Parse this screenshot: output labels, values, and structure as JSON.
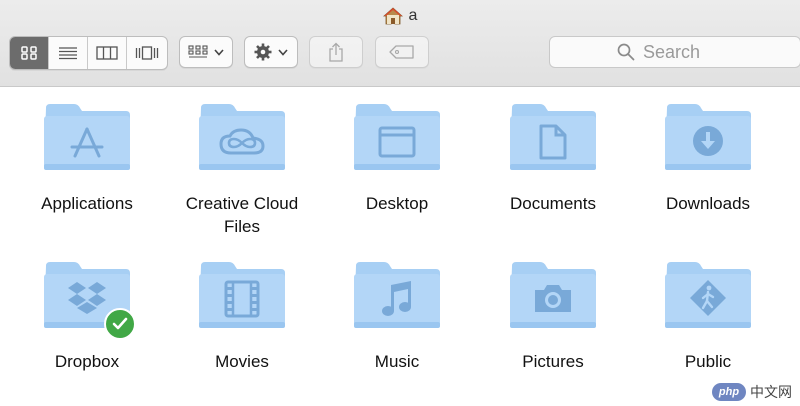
{
  "window": {
    "title": "a"
  },
  "toolbar": {
    "view_modes": [
      "icons",
      "list",
      "columns",
      "cover-flow"
    ],
    "active_view": "icons"
  },
  "search": {
    "placeholder": "Search"
  },
  "folders": [
    {
      "label": "Applications",
      "icon": "applications-icon"
    },
    {
      "label": "Creative Cloud Files",
      "icon": "creative-cloud-icon"
    },
    {
      "label": "Desktop",
      "icon": "desktop-icon"
    },
    {
      "label": "Documents",
      "icon": "document-icon"
    },
    {
      "label": "Downloads",
      "icon": "downloads-icon"
    },
    {
      "label": "Dropbox",
      "icon": "dropbox-icon",
      "synced": true
    },
    {
      "label": "Movies",
      "icon": "film-icon"
    },
    {
      "label": "Music",
      "icon": "music-note-icon"
    },
    {
      "label": "Pictures",
      "icon": "camera-icon"
    },
    {
      "label": "Public",
      "icon": "public-walker-icon"
    }
  ],
  "watermark": {
    "text": "中文网",
    "logo": "php"
  },
  "colors": {
    "folder": "#a7cff4",
    "folder_dark": "#8fbdeb",
    "badge": "#41a846"
  }
}
